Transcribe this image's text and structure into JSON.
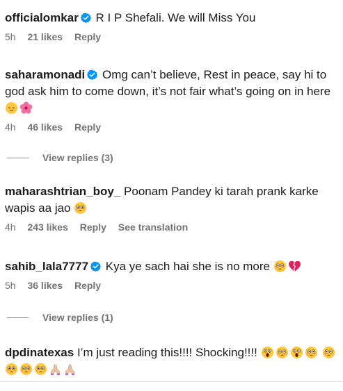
{
  "comments": [
    {
      "username": "officialomkar",
      "verified": true,
      "text": "R I P Shefali. We will Miss You",
      "time": "5h",
      "likes": "21 likes",
      "reply_label": "Reply"
    },
    {
      "username": "saharamonadi",
      "verified": true,
      "text": "Omg can’t believe, Rest in peace, say hi to god ask him to come down, it’s not fair what’s going on in here",
      "emojis": [
        "pensive-face",
        "hibiscus"
      ],
      "time": "4h",
      "likes": "46 likes",
      "reply_label": "Reply",
      "view_replies": "View replies (3)"
    },
    {
      "username": "maharashtrian_boy_",
      "verified": false,
      "text": "Poonam Pandey ki tarah prank karke wapis aa jao",
      "emojis": [
        "flushed-face"
      ],
      "time": "4h",
      "likes": "243 likes",
      "reply_label": "Reply",
      "translation_label": "See translation"
    },
    {
      "username": "sahib_lala7777",
      "verified": true,
      "text": "Kya ye sach hai she is no more",
      "emojis": [
        "flushed-face",
        "broken-heart"
      ],
      "time": "5h",
      "likes": "36 likes",
      "reply_label": "Reply",
      "view_replies": "View replies (1)"
    },
    {
      "username": "dpdinatexas",
      "verified": false,
      "text": "I’m just reading this!!!! Shocking!!!!",
      "emojis": [
        "screaming-face",
        "flushed-face",
        "screaming-face",
        "flushed-face",
        "flushed-face",
        "flushed-face",
        "flushed-face",
        "flushed-face",
        "praying-hands",
        "praying-hands"
      ]
    }
  ],
  "colors": {
    "verified_badge": "#0095f6",
    "meta_text": "#737373",
    "emoji_yellow": "#ffc83d"
  }
}
